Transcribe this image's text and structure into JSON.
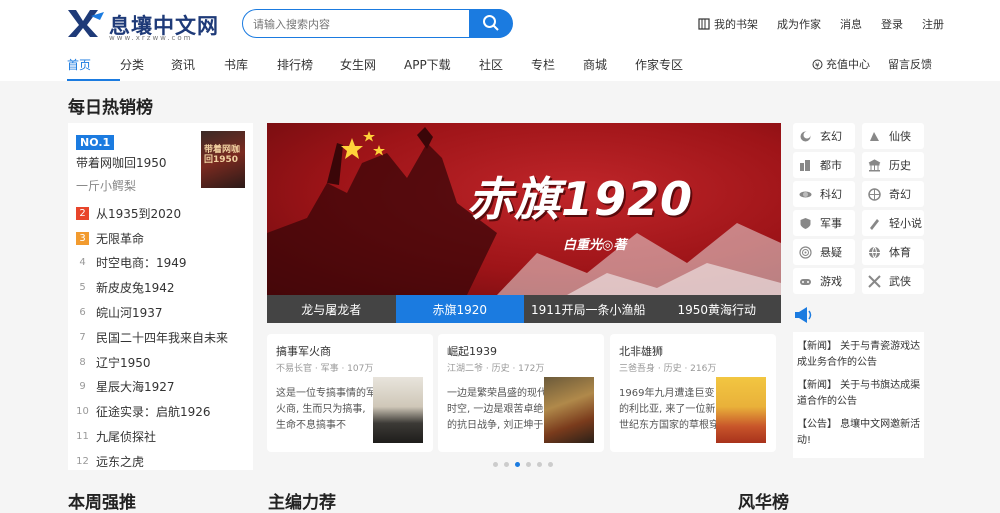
{
  "logo": {
    "name": "息壤中文网",
    "sub": "www.xrzww.com"
  },
  "search": {
    "placeholder": "请输入搜索内容"
  },
  "toplinks": [
    {
      "label": "我的书架",
      "icon": "bookshelf-icon"
    },
    {
      "label": "成为作家"
    },
    {
      "label": "消息"
    },
    {
      "label": "登录"
    },
    {
      "label": "注册"
    }
  ],
  "nav": [
    "首页",
    "分类",
    "资讯",
    "书库",
    "排行榜",
    "女生网",
    "APP下载",
    "社区",
    "专栏",
    "商城",
    "作家专区"
  ],
  "nav_right": [
    {
      "label": "充值中心",
      "icon": "coin-icon"
    },
    {
      "label": "留言反馈"
    }
  ],
  "hot": {
    "title": "每日热销榜",
    "top1": {
      "badge": "NO.1",
      "title": "带着网咖回1950",
      "author": "一斤小鳄梨",
      "cover_text": "带着网咖回1950"
    },
    "items": [
      {
        "num": "2",
        "title": "从1935到2020"
      },
      {
        "num": "3",
        "title": "无限革命"
      },
      {
        "num": "4",
        "title": "时空电商：1949"
      },
      {
        "num": "5",
        "title": "新皮皮兔1942"
      },
      {
        "num": "6",
        "title": "皖山河1937"
      },
      {
        "num": "7",
        "title": "民国二十四年我来自未来"
      },
      {
        "num": "8",
        "title": "辽宁1950"
      },
      {
        "num": "9",
        "title": "星辰大海1927"
      },
      {
        "num": "10",
        "title": "征途实录：启航1926"
      },
      {
        "num": "11",
        "title": "九尾侦探社"
      },
      {
        "num": "12",
        "title": "远东之虎"
      }
    ]
  },
  "banner": {
    "title": "赤旗1920",
    "author": "白重光◎著",
    "tabs": [
      "龙与屠龙者",
      "赤旗1920",
      "1911开局一条小渔船",
      "1950黄海行动"
    ],
    "active_tab": 1
  },
  "cards": [
    {
      "title": "搞事军火商",
      "meta": "不易长官 · 军事 · 107万",
      "desc": "这是一位专搞事情的军火商, 生而只为搞事, 生命不息搞事不"
    },
    {
      "title": "崛起1939",
      "meta": "江湖二爷 · 历史 · 172万",
      "desc": "一边是繁荣昌盛的现代时空, 一边是艰苦卓绝的抗日战争, 刘正坤于"
    },
    {
      "title": "北非雄狮",
      "meta": "三爸吾身 · 历史 · 216万",
      "desc": "1969年九月遭逢巨变的利比亚, 来了一位新世纪东方国家的草根穿越"
    }
  ],
  "carousel": {
    "count": 6,
    "active": 2
  },
  "genres": [
    {
      "label": "玄幻",
      "icon": "fantasy-icon"
    },
    {
      "label": "仙侠",
      "icon": "xianxia-icon"
    },
    {
      "label": "都市",
      "icon": "city-icon"
    },
    {
      "label": "历史",
      "icon": "history-icon"
    },
    {
      "label": "科幻",
      "icon": "scifi-icon"
    },
    {
      "label": "奇幻",
      "icon": "magic-icon"
    },
    {
      "label": "军事",
      "icon": "military-icon"
    },
    {
      "label": "轻小说",
      "icon": "light-novel-icon"
    },
    {
      "label": "悬疑",
      "icon": "mystery-icon"
    },
    {
      "label": "体育",
      "icon": "sports-icon"
    },
    {
      "label": "游戏",
      "icon": "game-icon"
    },
    {
      "label": "武侠",
      "icon": "wuxia-icon"
    }
  ],
  "notices": [
    "【新闻】 关于与青瓷游戏达成业务合作的公告",
    "【新闻】 关于与书旗达成渠道合作的公告",
    "【公告】 息壤中文网邀新活动!"
  ],
  "bottom_titles": [
    "本周强推",
    "主编力荐",
    "风华榜"
  ],
  "colors": {
    "accent": "#1b7be0",
    "rank2": "#e8452b",
    "rank3": "#f29b2f",
    "banner_red": "#b01c20"
  }
}
